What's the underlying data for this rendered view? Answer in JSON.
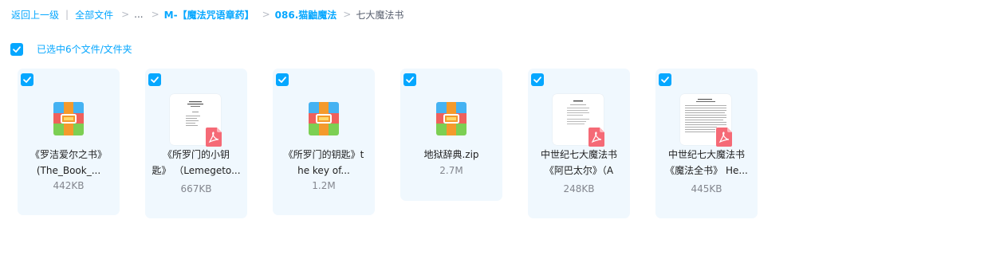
{
  "breadcrumb": {
    "back": "返回上一级",
    "all_files": "全部文件",
    "ellipsis": "...",
    "folder_1": "M-【魔法咒语章药】",
    "folder_2": "086.猫鼬魔法",
    "current": "七大魔法书"
  },
  "selection": {
    "label": "已选中6个文件/文件夹"
  },
  "files": [
    {
      "name_line1": "《罗洁爱尔之书》",
      "name_line2": "(The_Book_...",
      "size": "442KB",
      "type": "archive",
      "icon": "archive-icon"
    },
    {
      "name_line1": "《所罗门的小钥",
      "name_line2": "匙》 （Lemegeto...",
      "size": "667KB",
      "type": "pdf",
      "icon": "pdf-icon"
    },
    {
      "name_line1": "《所罗门的钥匙》t",
      "name_line2": "he key of...",
      "size": "1.2M",
      "type": "archive",
      "icon": "archive-icon"
    },
    {
      "name_line1": "地狱辞典.zip",
      "name_line2": "",
      "size": "2.7M",
      "type": "archive",
      "icon": "archive-icon"
    },
    {
      "name_line1": "中世纪七大魔法书",
      "name_line2": "《阿巴太尔》（A",
      "size": "248KB",
      "type": "pdf",
      "icon": "pdf-icon"
    },
    {
      "name_line1": "中世纪七大魔法书",
      "name_line2": "《魔法全书》 He...",
      "size": "445KB",
      "type": "pdf",
      "icon": "pdf-icon"
    }
  ],
  "colors": {
    "accent": "#06a7ff",
    "card_bg": "#f0f8fe",
    "pdf_badge": "#f56a76"
  }
}
